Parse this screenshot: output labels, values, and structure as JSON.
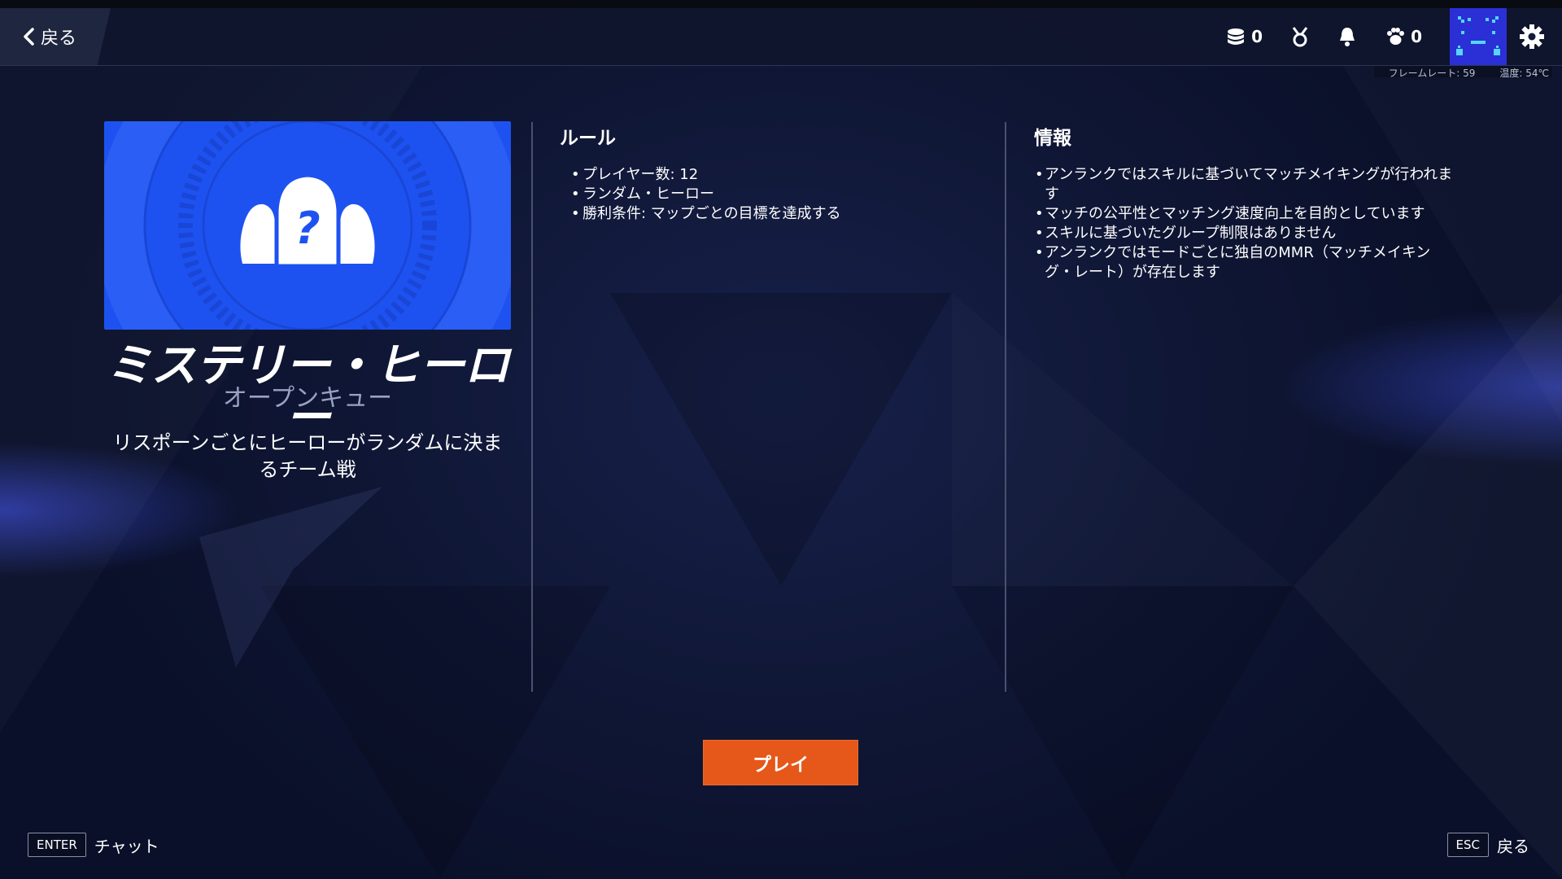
{
  "header": {
    "back_label": "戻る",
    "icons": [
      {
        "name": "coin-stack-icon",
        "count": "0"
      },
      {
        "name": "medal-icon"
      },
      {
        "name": "bell-icon"
      },
      {
        "name": "paw-icon",
        "count": "0"
      }
    ],
    "avatar": "avatar",
    "settings_icon": "gear-icon"
  },
  "stats": {
    "framerate": "フレームレート: 59",
    "temperature": "温度: 54℃"
  },
  "mode": {
    "card_icon": "mystery-heroes-icon",
    "title": "ミステリー・ヒーロー",
    "subtitle": "オープンキュー",
    "description": "リスポーンごとにヒーローがランダムに決まるチーム戦"
  },
  "rules": {
    "heading": "ルール",
    "items": [
      "プレイヤー数: 12",
      "ランダム・ヒーロー",
      "勝利条件: マップごとの目標を達成する"
    ]
  },
  "info": {
    "heading": "情報",
    "items": [
      "アンランクではスキルに基づいてマッチメイキングが行われます",
      "マッチの公平性とマッチング速度向上を目的としています",
      "スキルに基づいたグループ制限はありません",
      "アンランクではモードごとに独自のMMR（マッチメイキング・レート）が存在します"
    ]
  },
  "play_label": "プレイ",
  "footer": {
    "left_key": "ENTER",
    "left_label": "チャット",
    "right_key": "ESC",
    "right_label": "戻る"
  },
  "colors": {
    "accent": "#e5581a",
    "card": "#1e52f0",
    "background": "#0e1633"
  }
}
